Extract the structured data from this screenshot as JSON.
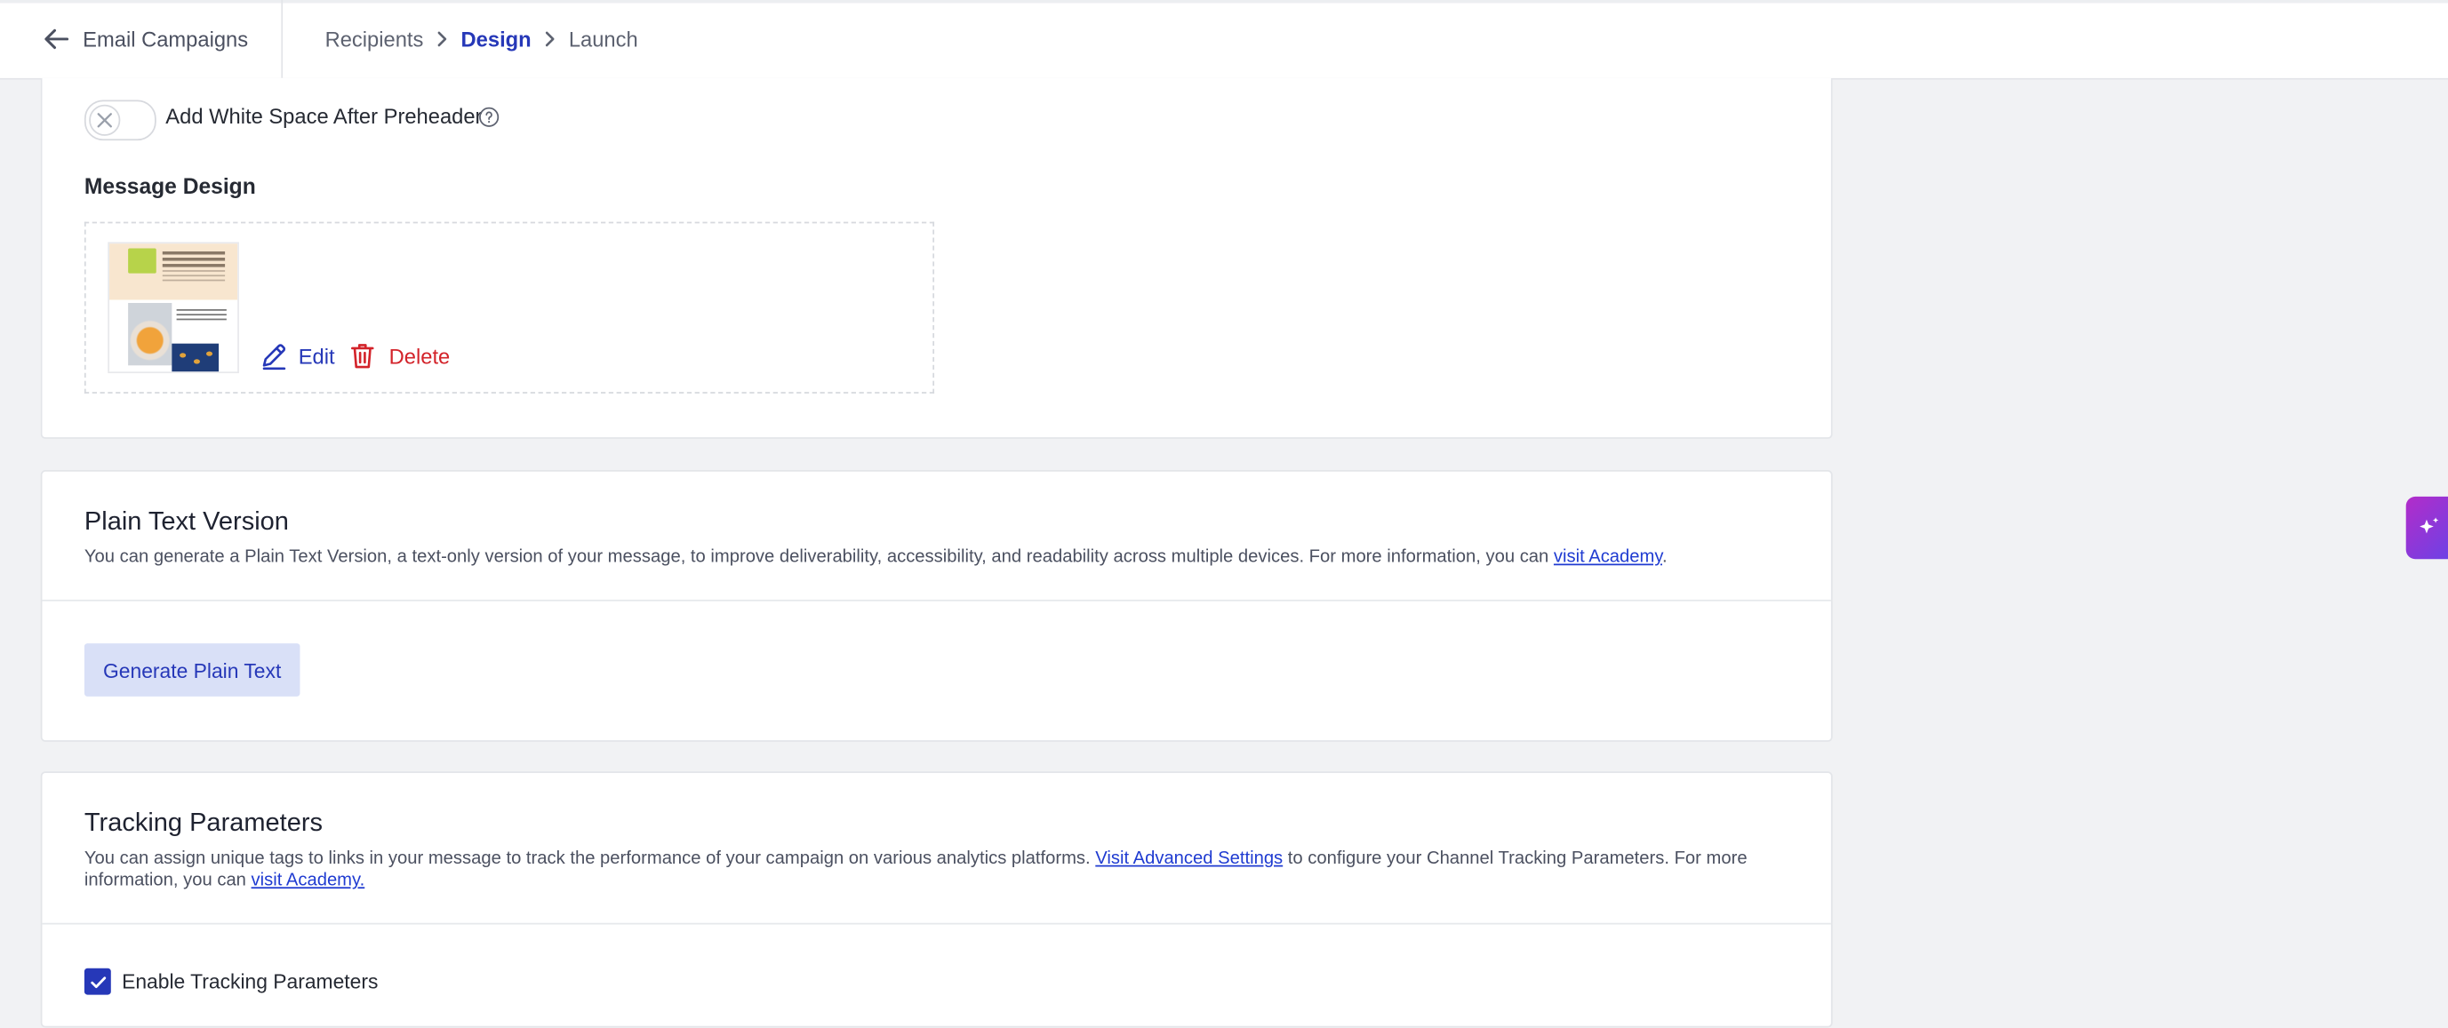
{
  "header": {
    "back_label": "Email Campaigns",
    "breadcrumb": [
      {
        "label": "Recipients",
        "active": false
      },
      {
        "label": "Design",
        "active": true
      },
      {
        "label": "Launch",
        "active": false
      }
    ]
  },
  "message_design_card": {
    "toggle_label": "Add White Space After Preheader",
    "toggle_on": false,
    "section_title": "Message Design",
    "edit_label": "Edit",
    "delete_label": "Delete"
  },
  "plain_text_card": {
    "title": "Plain Text Version",
    "description": "You can generate a Plain Text Version, a text-only version of your message, to improve deliverability, accessibility, and readability across multiple devices. For more information, you can ",
    "link": "visit Academy",
    "trailing": ".",
    "button_label": "Generate Plain Text"
  },
  "tracking_card": {
    "title": "Tracking Parameters",
    "description_part1": "You can assign unique tags to links in your message to track the performance of your campaign on various analytics platforms. ",
    "link1": "Visit Advanced Settings",
    "description_part2": " to configure your Channel Tracking Parameters. For more information, you can ",
    "link2": "visit Academy.",
    "checkbox_label": "Enable Tracking Parameters",
    "checkbox_checked": true
  },
  "colors": {
    "accent": "#2638b8",
    "danger": "#d3232a",
    "link": "#1f3bd1",
    "background": "#f1f2f4"
  },
  "icons": [
    "arrow-left-icon",
    "chevron-right-icon",
    "close-icon",
    "help-circle-icon",
    "pencil-icon",
    "trash-icon",
    "check-icon",
    "sparkles-icon"
  ]
}
